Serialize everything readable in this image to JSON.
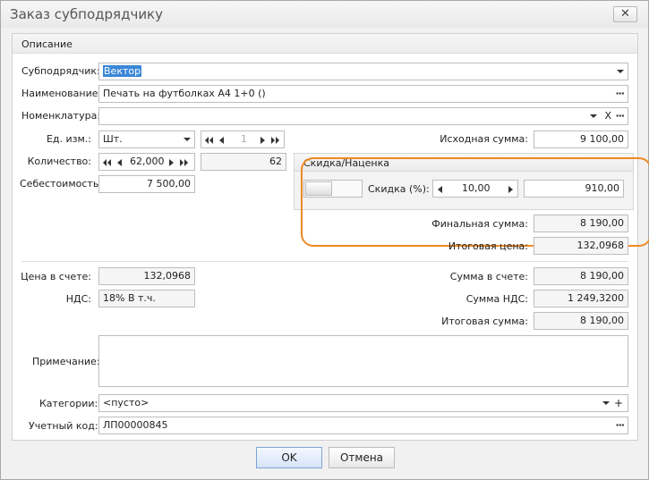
{
  "window": {
    "title": "Заказ субподрядчику",
    "close_label": "✕"
  },
  "group": {
    "header": "Описание"
  },
  "fields": {
    "subcontractor": {
      "label": "Субподрядчик:",
      "value": "Вектор"
    },
    "name": {
      "label": "Наименование:",
      "value": "Печать на футболках А4 1+0 ()"
    },
    "nomenclature": {
      "label": "Номенклатура:",
      "value": "",
      "clear": "X"
    },
    "unit": {
      "label": "Ед. изм.:",
      "value": "Шт."
    },
    "unit_pager": {
      "value": "1"
    },
    "quantity": {
      "label": "Количество:",
      "value": "62,000",
      "extra": "62"
    },
    "cost": {
      "label": "Себестоимость:",
      "value": "7 500,00"
    },
    "original_sum": {
      "label": "Исходная сумма:",
      "value": "9 100,00"
    },
    "final_sum": {
      "label": "Финальная сумма:",
      "value": "8 190,00"
    },
    "total_price": {
      "label": "Итоговая цена:",
      "value": "132,0968"
    },
    "invoice_price": {
      "label": "Цена в счете:",
      "value": "132,0968"
    },
    "vat": {
      "label": "НДС:",
      "value": "18% В т.ч."
    },
    "invoice_sum": {
      "label": "Сумма в счете:",
      "value": "8 190,00"
    },
    "vat_sum": {
      "label": "Сумма НДС:",
      "value": "1 249,3200"
    },
    "total_sum": {
      "label": "Итоговая сумма:",
      "value": "8 190,00"
    },
    "note": {
      "label": "Примечание:",
      "value": ""
    },
    "categories": {
      "label": "Категории:",
      "value": "<пусто>",
      "add": "+"
    },
    "account_code": {
      "label": "Учетный код:",
      "value": "ЛП00000845"
    }
  },
  "discount": {
    "header": "Скидка/Наценка",
    "label": "Скидка (%):",
    "percent": "10,00",
    "amount": "910,00"
  },
  "buttons": {
    "ok": "OK",
    "cancel": "Отмена"
  },
  "colors": {
    "highlight": "#f08a24",
    "selection": "#3a87d7"
  }
}
